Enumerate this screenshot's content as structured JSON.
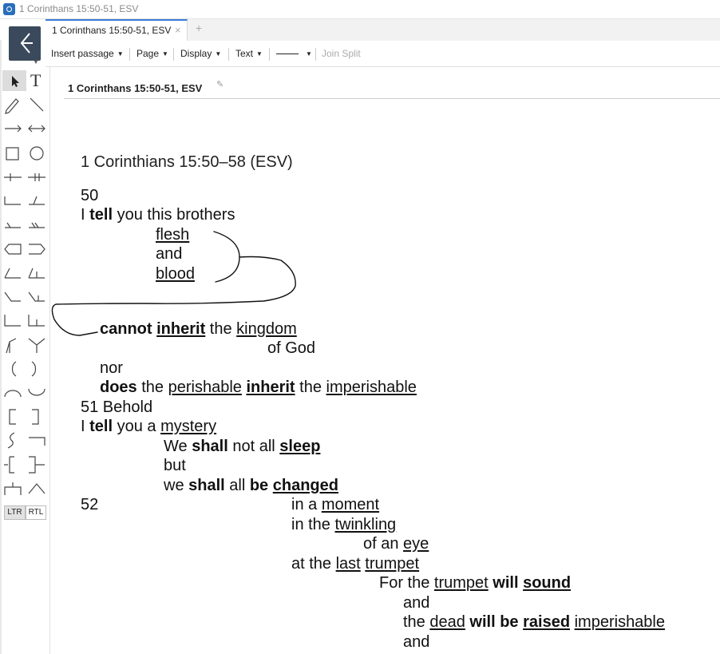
{
  "window": {
    "title": "1 Corinthans 15:50-51, ESV"
  },
  "tabs": [
    {
      "label": "1 Corinthans 15:50-51, ESV",
      "close": "×"
    }
  ],
  "tab_add": "+",
  "toolbar": {
    "insert_passage": "Insert passage",
    "page": "Page",
    "display": "Display",
    "text": "Text",
    "join_split": "Join Split",
    "caret": "▼"
  },
  "sidebar": {
    "text_tool": "T",
    "ltr": "LTR",
    "rtl": "RTL"
  },
  "document": {
    "title": "1 Corinthans 15:50-51, ESV",
    "heading": "1 Corinthians 15:50–58 (ESV)"
  },
  "passage": {
    "v50": "50",
    "l1": [
      "I ",
      "tell",
      " you this brothers"
    ],
    "flesh": "flesh",
    "and1": "and",
    "blood": "blood",
    "l2": [
      "cannot",
      " ",
      "inherit",
      " the ",
      "kingdom"
    ],
    "of_god": "of God",
    "nor": "nor",
    "l3": [
      "does",
      " the ",
      "perishable",
      " ",
      "inherit",
      " the ",
      "imperishable"
    ],
    "v51": "51 Behold",
    "l4": [
      "I ",
      "tell",
      " you a ",
      "mystery"
    ],
    "l5": [
      "We ",
      "shall",
      " not all ",
      "sleep"
    ],
    "but": "but",
    "l6": [
      "we ",
      "shall",
      " all ",
      "be",
      " ",
      "changed"
    ],
    "v52": "52",
    "l7": [
      "in a ",
      "moment"
    ],
    "l8": [
      "in the ",
      "twinkling"
    ],
    "l9": [
      "of an ",
      "eye"
    ],
    "l10": [
      "at the ",
      "last",
      " ",
      "trumpet"
    ],
    "l11": [
      "For the ",
      "trumpet",
      " ",
      "will",
      " ",
      "sound"
    ],
    "and2": "and",
    "l12": [
      "the ",
      "dead",
      " ",
      "will be",
      " ",
      "raised",
      " ",
      "imperishable"
    ],
    "and3": "and"
  }
}
